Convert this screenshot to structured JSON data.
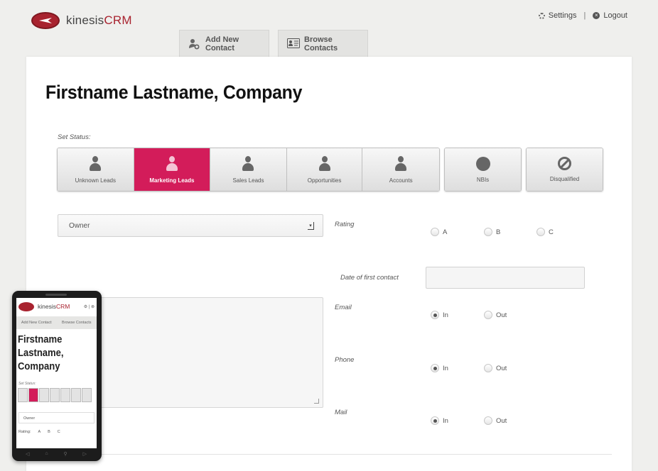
{
  "app": {
    "logo_main": "kinesis",
    "logo_accent": "CRM"
  },
  "topnav": {
    "settings": "Settings",
    "separator": "|",
    "logout": "Logout"
  },
  "tabs": [
    {
      "label": "Add New Contact",
      "icon": "add-user-icon"
    },
    {
      "label": "Browse Contacts",
      "icon": "contact-card-icon"
    }
  ],
  "page": {
    "title": "Firstname Lastname, Company"
  },
  "status": {
    "label": "Set Status:",
    "options": [
      {
        "label": "Unknown Leads",
        "icon": "person-icon",
        "active": false
      },
      {
        "label": "Marketing Leads",
        "icon": "person-icon",
        "active": true
      },
      {
        "label": "Sales Leads",
        "icon": "person-icon",
        "active": false
      },
      {
        "label": "Opportunities",
        "icon": "person-icon",
        "active": false
      },
      {
        "label": "Accounts",
        "icon": "person-icon",
        "active": false
      },
      {
        "label": "NBIs",
        "icon": "circle-icon",
        "active": false
      },
      {
        "label": "Disqualified",
        "icon": "ban-icon",
        "active": false
      }
    ],
    "active_color": "#d31c5a"
  },
  "form": {
    "owner": {
      "value": "Owner"
    },
    "rating": {
      "label": "Rating",
      "options": [
        "A",
        "B",
        "C"
      ],
      "selected": null
    },
    "date_first_contact": {
      "label": "Date of first contact",
      "value": ""
    },
    "email": {
      "label": "Email",
      "in": "In",
      "out": "Out",
      "selected": "In"
    },
    "phone": {
      "label": "Phone",
      "in": "In",
      "out": "Out",
      "selected": "In"
    },
    "mail": {
      "label": "Mail",
      "in": "In",
      "out": "Out",
      "selected": "In"
    },
    "notes": {
      "value": ""
    }
  },
  "mobile": {
    "logo_main": "kinesis",
    "logo_accent": "CRM",
    "tab1": "Add New Contact",
    "tab2": "Browse Contacts",
    "title": "Firstname Lastname, Company",
    "status_label": "Set Status:",
    "owner": "Owner",
    "rating_label": "Rating:",
    "rating_options": [
      "A",
      "B",
      "C"
    ]
  }
}
